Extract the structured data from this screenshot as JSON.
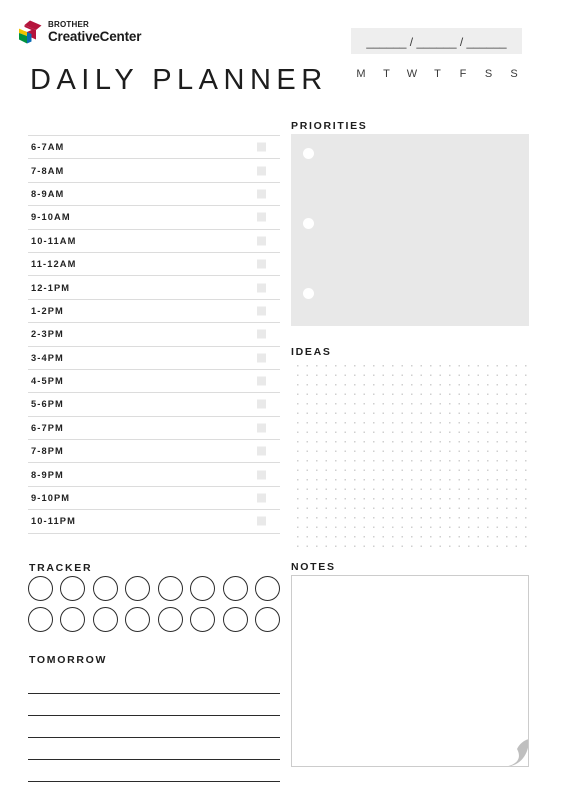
{
  "brand": {
    "logo_icon": "brother-diamond-logo-icon",
    "line1": "BROTHER",
    "line2": "CreativeCenter",
    "colors": {
      "red": "#b5143c",
      "yellow": "#f2c200",
      "green": "#00923f",
      "blue": "#0a6cb4",
      "text": "#1a1a1a"
    }
  },
  "header": {
    "title": "DAILY PLANNER",
    "date_field_value": "______ / ______ / ______",
    "date_field_bg": "#eeeeee",
    "weekdays": [
      "M",
      "T",
      "W",
      "T",
      "F",
      "S",
      "S"
    ]
  },
  "schedule": {
    "slots": [
      {
        "label": "6-7AM"
      },
      {
        "label": "7-8AM"
      },
      {
        "label": "8-9AM"
      },
      {
        "label": "9-10AM"
      },
      {
        "label": "10-11AM"
      },
      {
        "label": "11-12AM"
      },
      {
        "label": "12-1PM"
      },
      {
        "label": "1-2PM"
      },
      {
        "label": "2-3PM"
      },
      {
        "label": "3-4PM"
      },
      {
        "label": "4-5PM"
      },
      {
        "label": "5-6PM"
      },
      {
        "label": "6-7PM"
      },
      {
        "label": "7-8PM"
      },
      {
        "label": "8-9PM"
      },
      {
        "label": "9-10PM"
      },
      {
        "label": "10-11PM"
      }
    ],
    "checkbox_color": "#e9e9e9",
    "rule_color": "#dcdcdc"
  },
  "priorities": {
    "heading": "PRIORITIES",
    "bullet_count": 3,
    "bullet_tops": [
      14,
      84,
      154
    ],
    "panel_color": "#e8e8e8",
    "bullet_color": "#ffffff"
  },
  "ideas": {
    "heading": "IDEAS",
    "dot_color": "#cfcfcf",
    "dot_spacing_px": 9.5
  },
  "tracker": {
    "heading": "TRACKER",
    "rows": 2,
    "columns": 8,
    "circle_border_color": "#2b2b2b"
  },
  "tomorrow": {
    "heading": "TOMORROW",
    "line_count": 5,
    "line_color": "#2b2b2b"
  },
  "notes": {
    "heading": "NOTES",
    "border_color": "#cccccc",
    "curl_color": "#bfbfbf",
    "curl_icon": "page-curl-icon"
  }
}
